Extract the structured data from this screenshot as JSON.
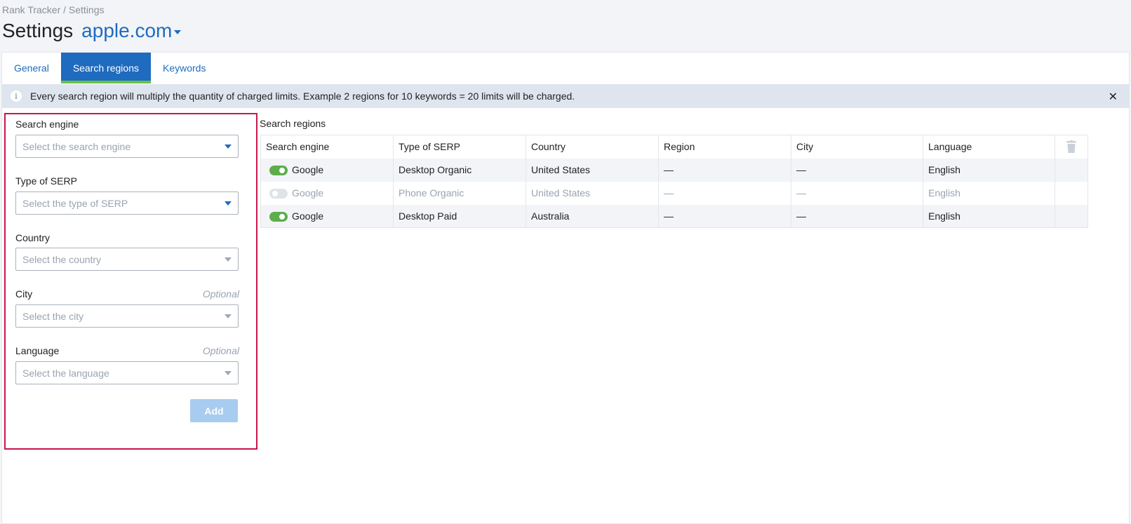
{
  "breadcrumb": "Rank Tracker / Settings",
  "page_title": "Settings",
  "project": "apple.com",
  "tabs": [
    {
      "label": "General",
      "active": false
    },
    {
      "label": "Search regions",
      "active": true
    },
    {
      "label": "Keywords",
      "active": false
    }
  ],
  "notice": "Every search region will multiply the quantity of charged limits. Example 2 regions for 10 keywords = 20 limits will be charged.",
  "form": {
    "search_engine": {
      "label": "Search engine",
      "placeholder": "Select the search engine"
    },
    "serp_type": {
      "label": "Type of SERP",
      "placeholder": "Select the type of SERP"
    },
    "country": {
      "label": "Country",
      "placeholder": "Select the country"
    },
    "city": {
      "label": "City",
      "optional": "Optional",
      "placeholder": "Select the city"
    },
    "language": {
      "label": "Language",
      "optional": "Optional",
      "placeholder": "Select the language"
    },
    "add_label": "Add"
  },
  "regions": {
    "title": "Search regions",
    "columns": [
      "Search engine",
      "Type of SERP",
      "Country",
      "Region",
      "City",
      "Language"
    ],
    "rows": [
      {
        "enabled": true,
        "engine": "Google",
        "serp": "Desktop Organic",
        "country": "United States",
        "region": "—",
        "city": "—",
        "language": "English"
      },
      {
        "enabled": false,
        "engine": "Google",
        "serp": "Phone Organic",
        "country": "United States",
        "region": "—",
        "city": "—",
        "language": "English"
      },
      {
        "enabled": true,
        "engine": "Google",
        "serp": "Desktop Paid",
        "country": "Australia",
        "region": "—",
        "city": "—",
        "language": "English"
      }
    ]
  },
  "colors": {
    "accent": "#1f6bbf",
    "active_tab_underline": "#6cc04a",
    "form_highlight_border": "#c8174a",
    "toggle_on": "#5cae4a"
  }
}
